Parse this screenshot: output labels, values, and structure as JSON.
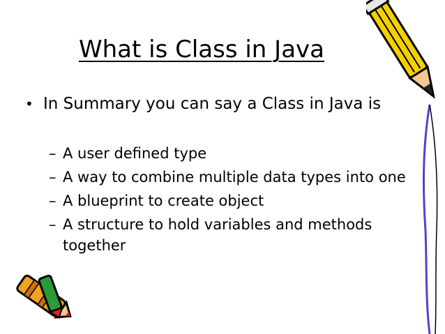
{
  "slide": {
    "title": "What is Class in Java",
    "bullet": {
      "marker": "•",
      "text": "In Summary you can say a Class in Java is"
    },
    "sub_marker": "–",
    "sub_items": [
      "A user defined type",
      "A way to combine multiple data types into one",
      "A blueprint to create object",
      "A structure to hold variables and methods together"
    ]
  },
  "colors": {
    "pencil_body": "#f5d000",
    "pencil_outline": "#000000",
    "crayon_body": "#f4a020",
    "crayon_tip": "#e02020",
    "crayon_cap": "#2a9a3a",
    "curve_line": "#5b3ec8"
  },
  "decorations": [
    "pencil-clipart",
    "crayon-clipart",
    "page-curl-line"
  ]
}
